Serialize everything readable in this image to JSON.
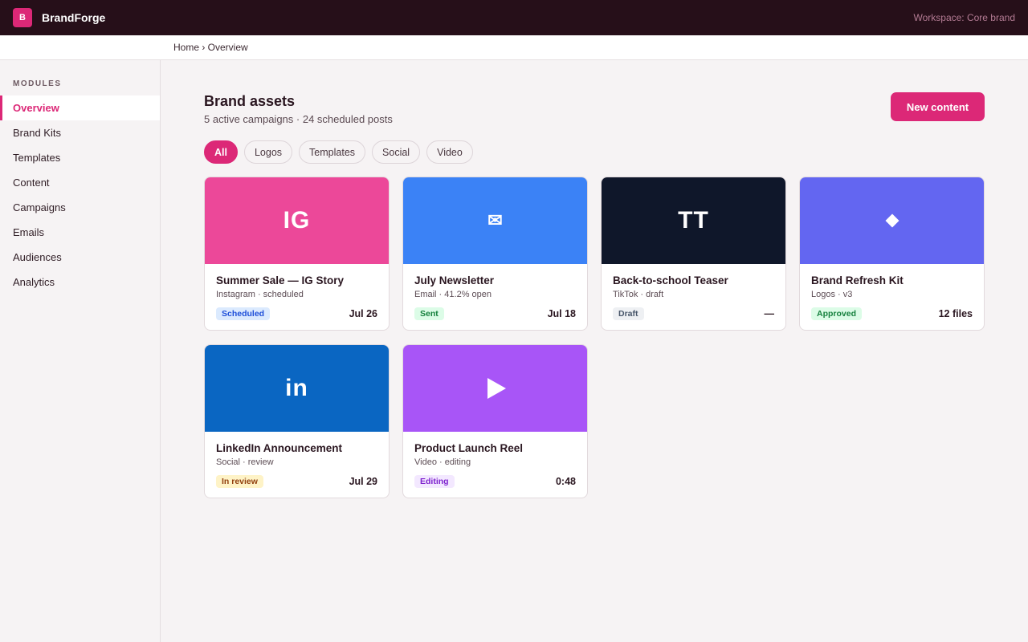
{
  "app": {
    "logo_letter": "B",
    "name": "BrandForge",
    "workspace": "Workspace: Core brand"
  },
  "breadcrumb": "Home › Overview",
  "sidebar": {
    "heading": "MODULES",
    "items": [
      {
        "label": "Overview",
        "active": true
      },
      {
        "label": "Brand Kits"
      },
      {
        "label": "Templates"
      },
      {
        "label": "Content"
      },
      {
        "label": "Campaigns"
      },
      {
        "label": "Emails"
      },
      {
        "label": "Audiences"
      },
      {
        "label": "Analytics"
      }
    ]
  },
  "header": {
    "title": "Brand assets",
    "subtitle": "5 active campaigns · 24 scheduled posts",
    "new_button": "New content"
  },
  "filters": [
    "All",
    "Logos",
    "Templates",
    "Social",
    "Video"
  ],
  "cards": [
    {
      "thumb_text": "IG",
      "thumb_icon": "instagram-icon",
      "color": "#ec4899",
      "title": "Summer Sale — IG Story",
      "meta": "Instagram · scheduled",
      "badge": "Scheduled",
      "badge_bg": "#dbeafe",
      "badge_fg": "#1d4ed8",
      "right": "Jul 26"
    },
    {
      "thumb_text": "✉",
      "thumb_icon": "envelope-icon",
      "color": "#3b82f6",
      "title": "July Newsletter",
      "meta": "Email · 41.2% open",
      "badge": "Sent",
      "badge_bg": "#dcfce7",
      "badge_fg": "#15803d",
      "right": "Jul 18"
    },
    {
      "thumb_text": "TT",
      "thumb_icon": "tiktok-icon",
      "color": "#0f172a",
      "title": "Back-to-school Teaser",
      "meta": "TikTok · draft",
      "badge": "Draft",
      "badge_bg": "#eef0f3",
      "badge_fg": "#475569",
      "right": "—"
    },
    {
      "thumb_text": "",
      "thumb_icon": "diamond-icon",
      "color": "#6366f1",
      "title": "Brand Refresh Kit",
      "meta": "Logos · v3",
      "badge": "Approved",
      "badge_bg": "#dcfce7",
      "badge_fg": "#15803d",
      "right": "12 files"
    },
    {
      "thumb_text": "in",
      "thumb_icon": "linkedin-icon",
      "color": "#0a66c2",
      "title": "LinkedIn Announcement",
      "meta": "Social · review",
      "badge": "In review",
      "badge_bg": "#fef3c7",
      "badge_fg": "#92400e",
      "right": "Jul 29"
    },
    {
      "thumb_text": "",
      "thumb_icon": "play-icon",
      "color": "#a855f7",
      "title": "Product Launch Reel",
      "meta": "Video · editing",
      "badge": "Editing",
      "badge_bg": "#f3e8ff",
      "badge_fg": "#7e22ce",
      "right": "0:48"
    }
  ]
}
